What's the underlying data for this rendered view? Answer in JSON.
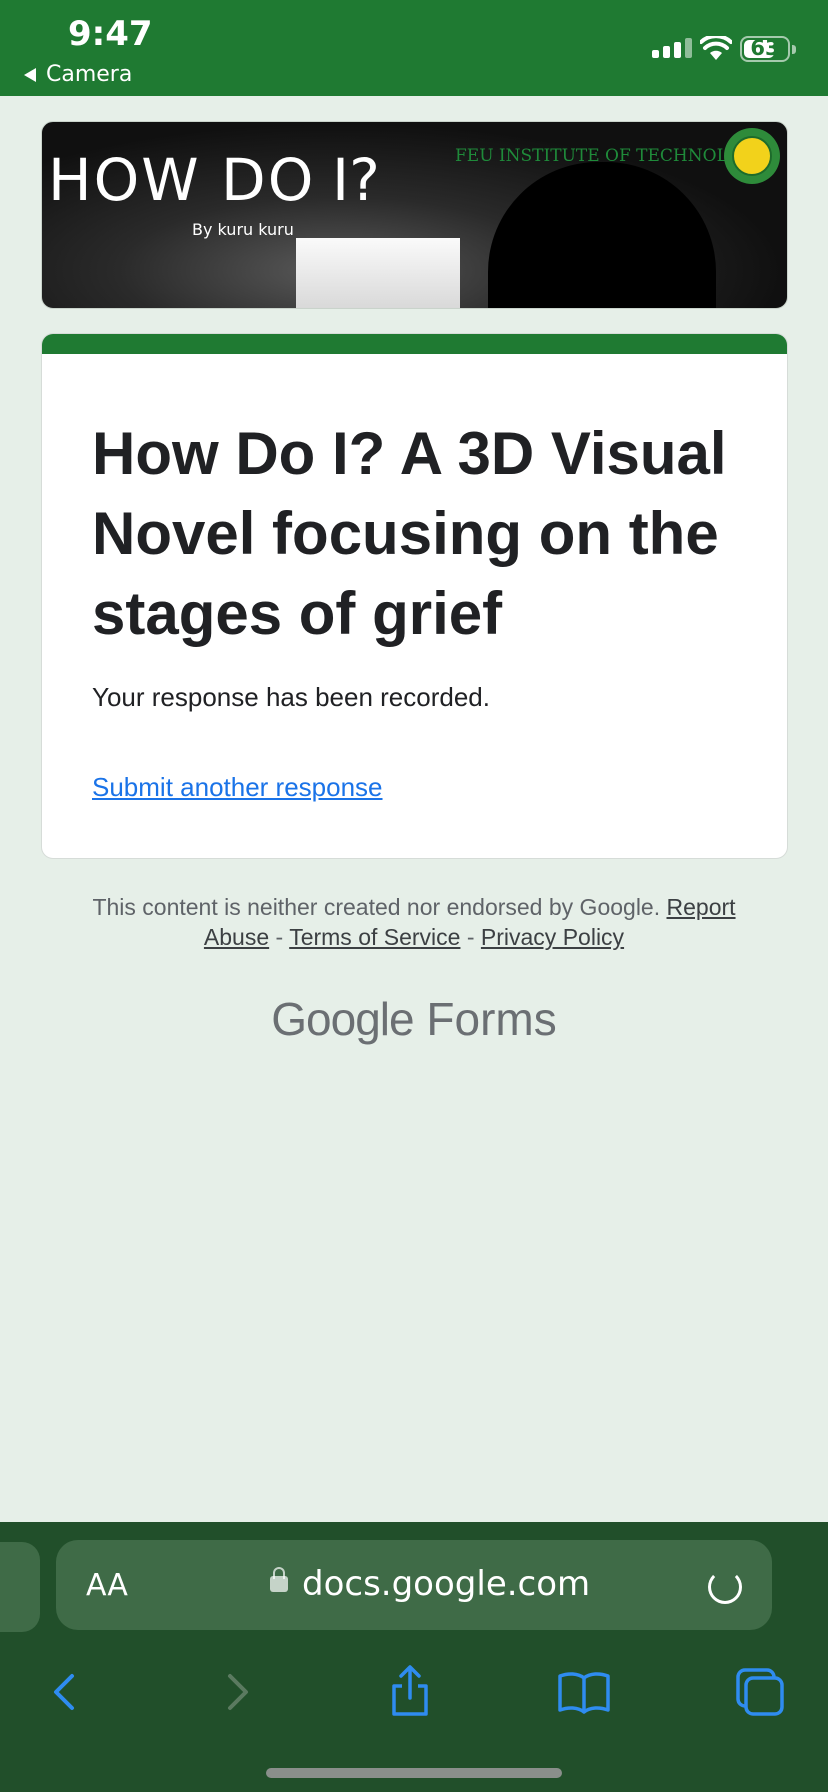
{
  "status_bar": {
    "time": "9:47",
    "back_app": "Camera",
    "battery": "63"
  },
  "banner": {
    "title_left": "HOW DO",
    "title_right": "I?",
    "byline": "By kuru kuru",
    "institution": "FEU INSTITUTE OF TECHNOLOGY"
  },
  "form": {
    "title": "How Do I? A 3D Visual Novel focusing on the stages of grief",
    "confirmation": "Your response has been recorded.",
    "submit_another": "Submit another response"
  },
  "footer": {
    "disclaimer": "This content is neither created nor endorsed by Google.",
    "report_abuse": "Report Abuse",
    "separator": "-",
    "terms": "Terms of Service",
    "privacy": "Privacy Policy",
    "brand_google": "Google",
    "brand_forms": "Forms"
  },
  "browser": {
    "text_size_label": "AA",
    "host": "docs.google.com"
  },
  "colors": {
    "accent": "#1f7a32",
    "link": "#1a73e8",
    "background": "#e6efe8"
  }
}
